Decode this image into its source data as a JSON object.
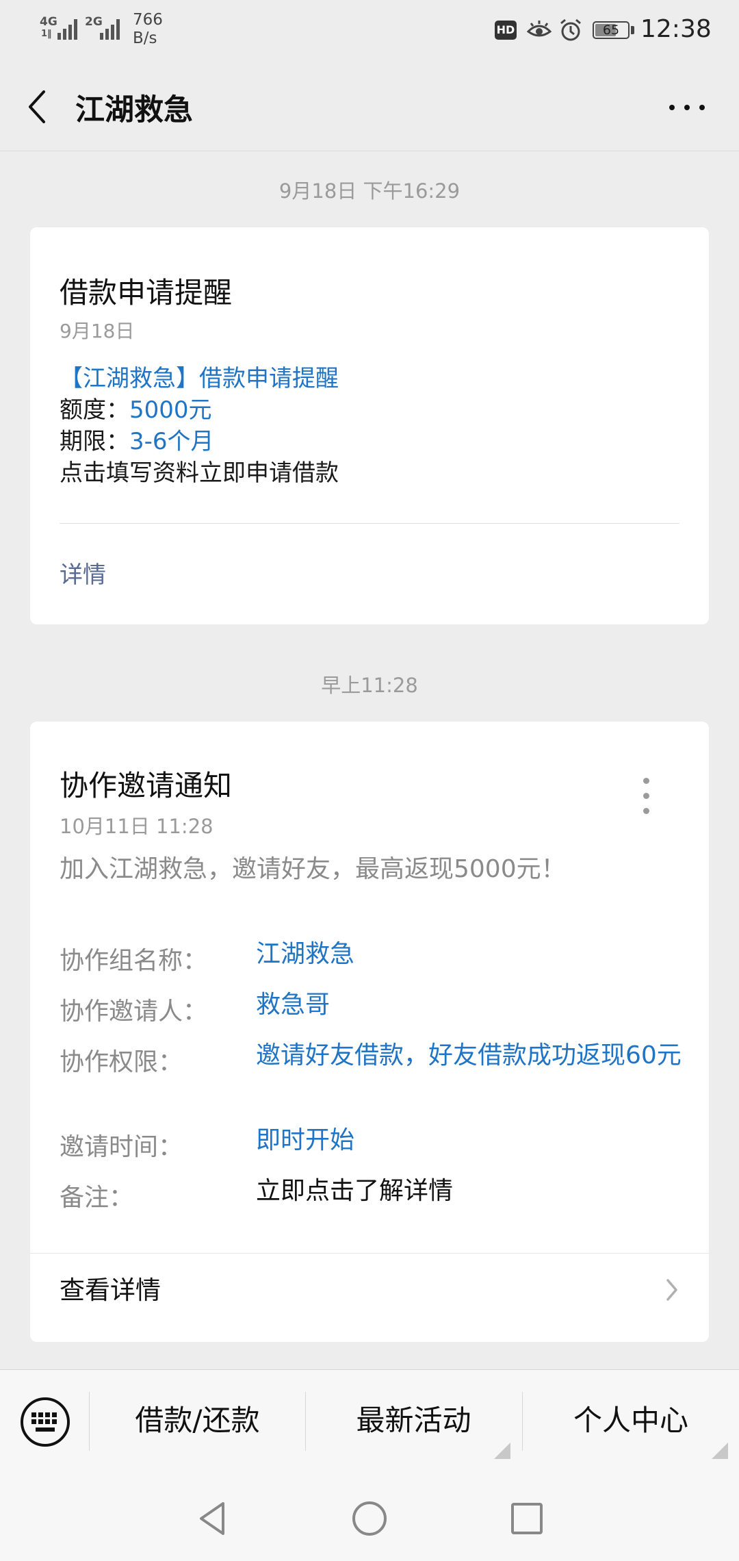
{
  "status_bar": {
    "sig1_label_top": "4G",
    "sig1_label_bottom": "1‖",
    "sig2_label_top": "2G",
    "net_speed_value": "766",
    "net_speed_unit": "B/s",
    "hd": "HD",
    "battery_level": 65,
    "battery_text": "65",
    "time": "12:38"
  },
  "header": {
    "title": "江湖救急"
  },
  "timestamp_1": "9月18日 下午16:29",
  "card1": {
    "title": "借款申请提醒",
    "date": "9月18日",
    "headline": "【江湖救急】借款申请提醒",
    "amount_label": "额度：",
    "amount_value": "5000元",
    "term_label": "期限：",
    "term_value": "3-6个月",
    "cta": "点击填写资料立即申请借款",
    "details_link": "详情"
  },
  "timestamp_2": "早上11:28",
  "card2": {
    "title": "协作邀请通知",
    "date": "10月11日  11:28",
    "subtitle": "加入江湖救急，邀请好友，最高返现5000元！",
    "fields": [
      {
        "label": "协作组名称：",
        "value": "江湖救急"
      },
      {
        "label": "协作邀请人：",
        "value": "救急哥"
      },
      {
        "label": "协作权限：",
        "value": "邀请好友借款，好友借款成功返现60元"
      },
      {
        "label": "邀请时间：",
        "value": "即时开始"
      },
      {
        "label": "备注：",
        "value": "立即点击了解详情"
      }
    ],
    "view_details": "查看详情"
  },
  "menu_bar": {
    "items": [
      "借款/还款",
      "最新活动",
      "个人中心"
    ]
  },
  "colors": {
    "link_blue": "#1f74c5",
    "details_link": "#576b95",
    "background": "#ededed"
  },
  "icons": [
    "back-arrow-icon",
    "more-dots-icon",
    "keyboard-icon",
    "chevron-right-icon",
    "eye-icon",
    "alarm-icon",
    "nav-back-icon",
    "nav-home-icon",
    "nav-recent-icon"
  ]
}
